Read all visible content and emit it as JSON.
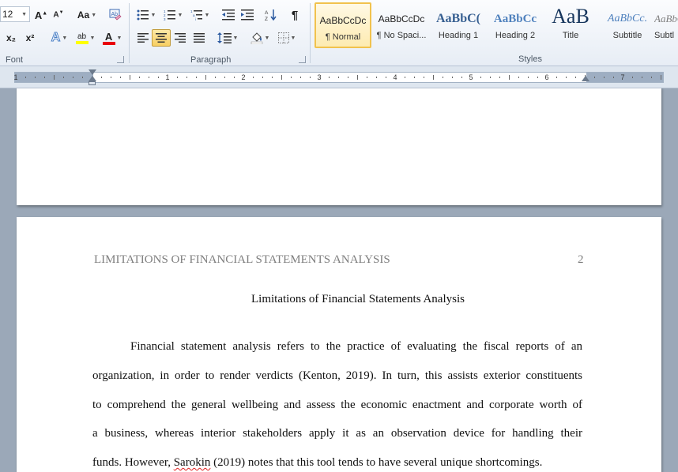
{
  "ribbon": {
    "font": {
      "label": "Font",
      "size": "12",
      "grow_icon": "A▲",
      "shrink_icon": "A▼",
      "change_case": "Aa",
      "subscript": "x₂",
      "superscript": "x²",
      "text_effects": "A",
      "highlight": "ab",
      "font_color": "A",
      "clear_format_icon": "clear-formatting"
    },
    "paragraph": {
      "label": "Paragraph",
      "pilcrow": "¶"
    },
    "styles": {
      "label": "Styles",
      "items": [
        {
          "preview": "AaBbCcDc",
          "name": "¶ Normal"
        },
        {
          "preview": "AaBbCcDc",
          "name": "¶ No Spaci..."
        },
        {
          "preview": "AaBbC(",
          "name": "Heading 1"
        },
        {
          "preview": "AaBbCc",
          "name": "Heading 2"
        },
        {
          "preview": "AaB",
          "name": "Title"
        },
        {
          "preview": "AaBbCc.",
          "name": "Subtitle"
        },
        {
          "preview": "AaBbCcL",
          "name": "Subtl"
        }
      ]
    }
  },
  "ruler": {
    "numbers": [
      "1",
      "1",
      "2",
      "3",
      "4",
      "5",
      "6",
      "7"
    ]
  },
  "document": {
    "running_head": "LIMITATIONS OF FINANCIAL STATEMENTS ANALYSIS",
    "page_number": "2",
    "title": "Limitations of Financial Statements Analysis",
    "lines": [
      "Financial statement analysis refers to the practice of evaluating the fiscal reports of an",
      "organization, in order to render verdicts (Kenton, 2019). In turn, this assists exterior constituents",
      "to comprehend the general wellbeing and assess the economic enactment and corporate worth of",
      "a business, whereas interior stakeholders apply it as an observation device for handling their"
    ],
    "last_line_pre": "funds. However, ",
    "last_line_spell": "Sarokin",
    "last_line_post": " (2019) notes that this tool tends to have several unique shortcomings."
  },
  "colors": {
    "font_color_bar": "#e8000b",
    "highlight_bar": "#ffff00",
    "selected_style_border": "#f1c24d"
  }
}
